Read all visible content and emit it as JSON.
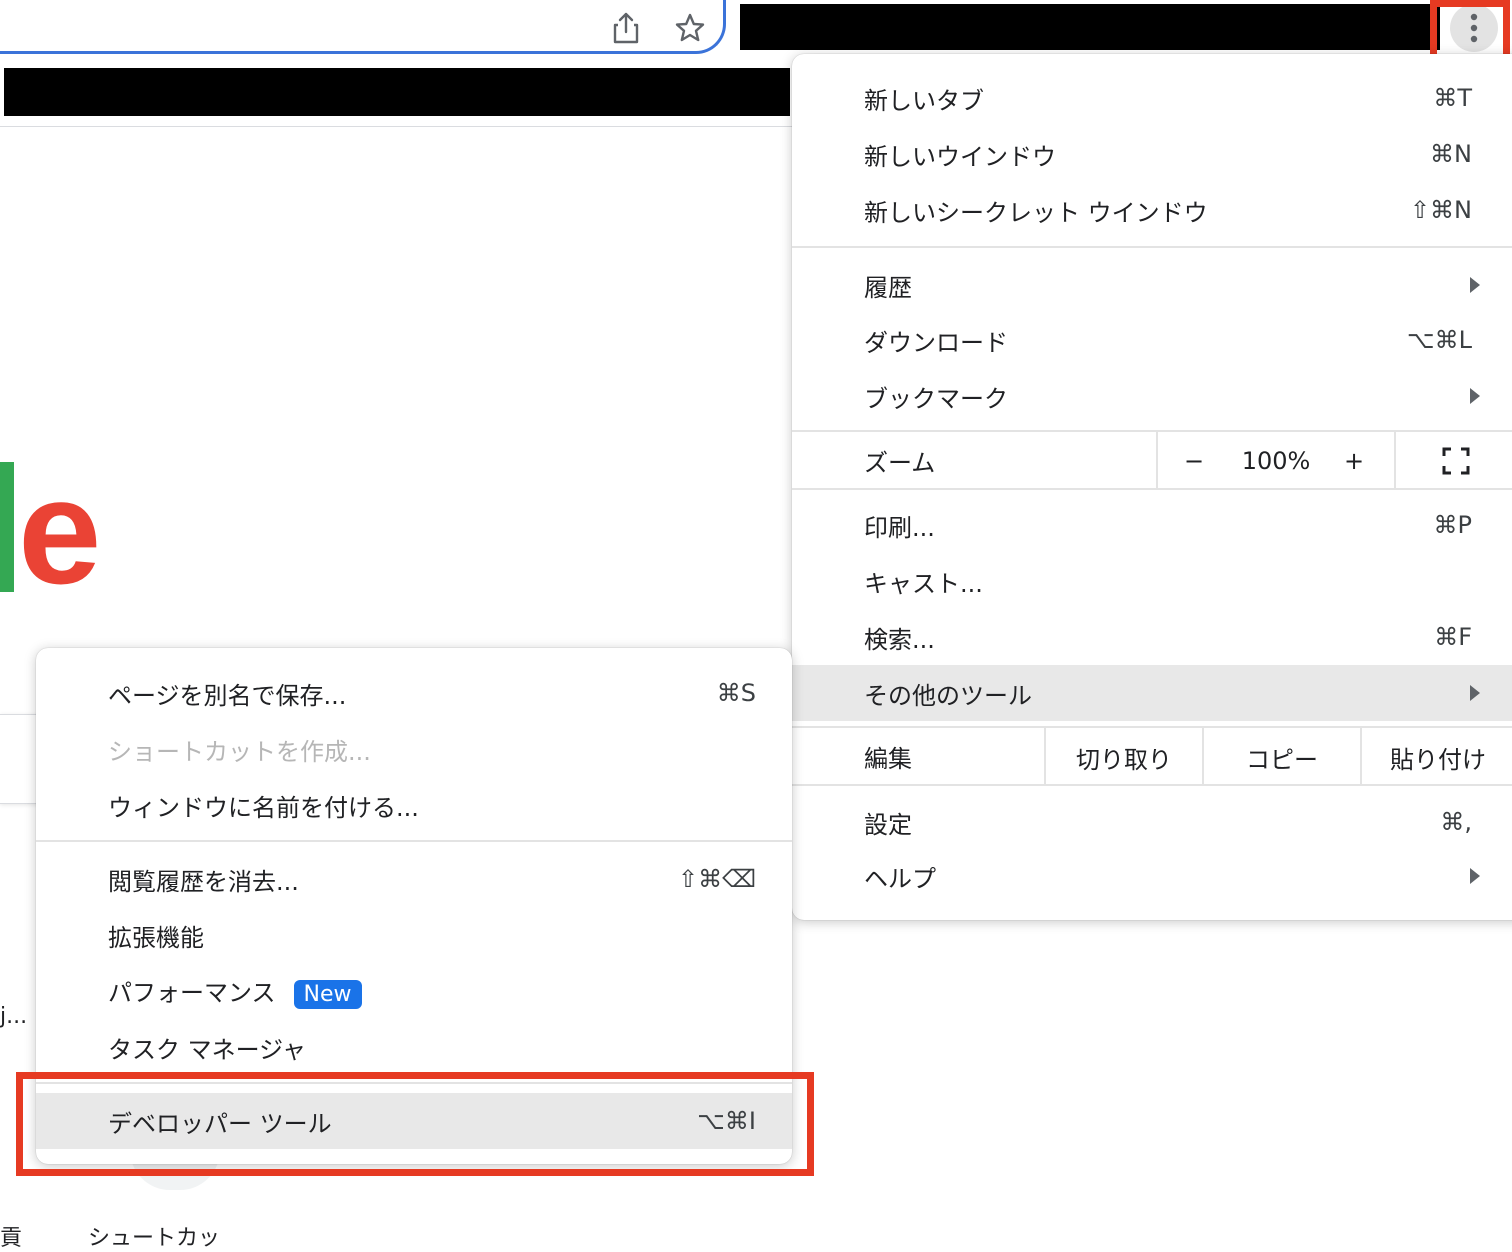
{
  "toolbar": {
    "share_icon": "share-icon",
    "bookmark_icon": "star-icon",
    "menu_icon": "kebab-menu-icon"
  },
  "background": {
    "logo_fragment": "e",
    "link_fragment": "j...",
    "bottom_text_1": "貢",
    "bottom_text_2": "シュートカッ"
  },
  "main_menu": {
    "items": [
      {
        "label": "新しいタブ",
        "shortcut": "⌘T"
      },
      {
        "label": "新しいウインドウ",
        "shortcut": "⌘N"
      },
      {
        "label": "新しいシークレット ウインドウ",
        "shortcut": "⇧⌘N"
      },
      {
        "label": "履歴",
        "shortcut": ""
      },
      {
        "label": "ダウンロード",
        "shortcut": "⌥⌘L"
      },
      {
        "label": "ブックマーク",
        "shortcut": ""
      },
      {
        "label": "印刷...",
        "shortcut": "⌘P"
      },
      {
        "label": "キャスト...",
        "shortcut": ""
      },
      {
        "label": "検索...",
        "shortcut": "⌘F"
      },
      {
        "label": "その他のツール",
        "shortcut": ""
      },
      {
        "label": "設定",
        "shortcut": "⌘,"
      },
      {
        "label": "ヘルプ",
        "shortcut": ""
      }
    ],
    "zoom": {
      "label": "ズーム",
      "minus": "−",
      "value": "100%",
      "plus": "+",
      "fullscreen_icon": "fullscreen-icon"
    },
    "edit": {
      "label": "編集",
      "cut": "切り取り",
      "copy": "コピー",
      "paste": "貼り付け"
    }
  },
  "sub_menu": {
    "items": [
      {
        "label": "ページを別名で保存...",
        "shortcut": "⌘S"
      },
      {
        "label": "ショートカットを作成...",
        "shortcut": ""
      },
      {
        "label": "ウィンドウに名前を付ける...",
        "shortcut": ""
      },
      {
        "label": "閲覧履歴を消去...",
        "shortcut": "⇧⌘⌫"
      },
      {
        "label": "拡張機能",
        "shortcut": ""
      },
      {
        "label": "パフォーマンス",
        "shortcut": "",
        "badge": "New"
      },
      {
        "label": "タスク マネージャ",
        "shortcut": ""
      },
      {
        "label": "デベロッパー ツール",
        "shortcut": "⌥⌘I"
      }
    ]
  },
  "colors": {
    "highlight_box": "#e63a22",
    "badge": "#1a73e8",
    "omnibox_border": "#3b73d9"
  }
}
